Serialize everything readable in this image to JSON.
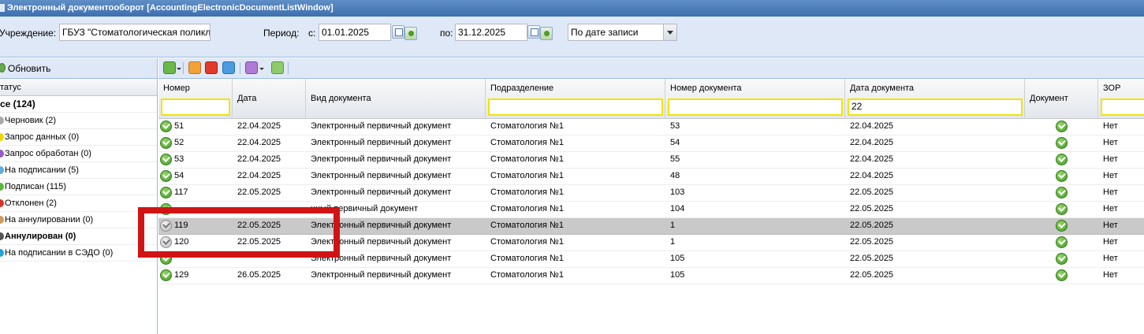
{
  "window": {
    "title": "Электронный документооборот [AccountingElectronicDocumentListWindow]"
  },
  "filters": {
    "institution_label": "Учреждение:",
    "institution_value": "ГБУЗ \"Стоматологическая поликл",
    "period_label": "Период:",
    "from_label": "с:",
    "from_value": "01.01.2025",
    "to_label": "по:",
    "to_value": "31.12.2025",
    "sort_value": "По дате записи"
  },
  "status_panel": {
    "refresh_label": "Обновить",
    "header": "татус",
    "items": [
      {
        "label": "се (124)",
        "color": ""
      },
      {
        "label": "Черновик (2)",
        "color": "#a9a9a9"
      },
      {
        "label": "Запрос данных (0)",
        "color": "#f2d600"
      },
      {
        "label": "Запрос обработан (0)",
        "color": "#9a5bc9"
      },
      {
        "label": "На подписании (5)",
        "color": "#5aaee0"
      },
      {
        "label": "Подписан (115)",
        "color": "#5cb83a"
      },
      {
        "label": "Отклонен (2)",
        "color": "#d9352b"
      },
      {
        "label": "На аннулировании (0)",
        "color": "#d29a5a"
      },
      {
        "label": "Аннулирован (0)",
        "color": "#555555"
      },
      {
        "label": "На подписании в СЭДО (0)",
        "color": "#1fa6d9"
      }
    ]
  },
  "grid": {
    "columns": {
      "number": "Номер",
      "date": "Дата",
      "doc_type": "Вид документа",
      "department": "Подразделение",
      "doc_number": "Номер документа",
      "doc_date": "Дата документа",
      "document": "Документ",
      "zor": "ЗОР"
    },
    "filter_doc_date": "22",
    "rows": [
      {
        "status": "ok",
        "number": "51",
        "date": "22.04.2025",
        "doc_type": "Электронный первичный документ",
        "department": "Стоматология №1",
        "doc_number": "53",
        "doc_date": "22.04.2025",
        "zor": "Нет"
      },
      {
        "status": "ok",
        "number": "52",
        "date": "22.04.2025",
        "doc_type": "Электронный первичный документ",
        "department": "Стоматология №1",
        "doc_number": "54",
        "doc_date": "22.04.2025",
        "zor": "Нет"
      },
      {
        "status": "ok",
        "number": "53",
        "date": "22.04.2025",
        "doc_type": "Электронный первичный документ",
        "department": "Стоматология №1",
        "doc_number": "55",
        "doc_date": "22.04.2025",
        "zor": "Нет"
      },
      {
        "status": "ok",
        "number": "54",
        "date": "22.04.2025",
        "doc_type": "Электронный первичный документ",
        "department": "Стоматология №1",
        "doc_number": "48",
        "doc_date": "22.04.2025",
        "zor": "Нет"
      },
      {
        "status": "ok",
        "number": "117",
        "date": "22.05.2025",
        "doc_type": "Электронный первичный документ",
        "department": "Стоматология №1",
        "doc_number": "103",
        "doc_date": "22.05.2025",
        "zor": "Нет"
      },
      {
        "status": "ok",
        "number": "",
        "date": "",
        "doc_type": "нный первичный документ",
        "department": "Стоматология №1",
        "doc_number": "104",
        "doc_date": "22.05.2025",
        "zor": "Нет"
      },
      {
        "status": "draft",
        "number": "119",
        "date": "22.05.2025",
        "doc_type": "Электронный первичный документ",
        "department": "Стоматология №1",
        "doc_number": "1",
        "doc_date": "22.05.2025",
        "zor": "Нет",
        "selected": true
      },
      {
        "status": "draft",
        "number": "120",
        "date": "22.05.2025",
        "doc_type": "Электронный первичный документ",
        "department": "Стоматология №1",
        "doc_number": "1",
        "doc_date": "22.05.2025",
        "zor": "Нет"
      },
      {
        "status": "ok",
        "number": "",
        "date": "",
        "doc_type": "Электронный первичный документ",
        "department": "Стоматология №1",
        "doc_number": "105",
        "doc_date": "22.05.2025",
        "zor": "Нет"
      },
      {
        "status": "ok",
        "number": "129",
        "date": "26.05.2025",
        "doc_type": "Электронный первичный документ",
        "department": "Стоматология №1",
        "doc_number": "105",
        "doc_date": "22.05.2025",
        "zor": "Нет"
      }
    ]
  },
  "colors": {
    "highlight": "#d01414",
    "filter_border": "#f2e400"
  }
}
